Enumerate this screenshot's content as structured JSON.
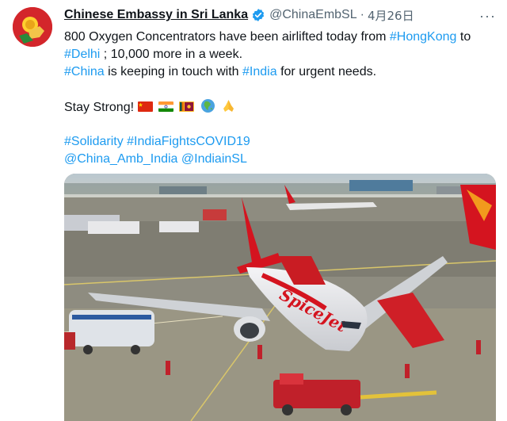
{
  "author": {
    "name": "Chinese Embassy in Sri Lanka",
    "handle": "@ChinaEmbSL",
    "date": "4月26日",
    "verified_icon": "verified-badge-icon",
    "more_icon": "more-options-icon"
  },
  "tweet": {
    "l1_pre": "800 Oxygen Concentrators have been airlifted today from ",
    "l1_tag": "#HongKong",
    "l1_post": " to",
    "l2_tag": "#Delhi",
    "l2_post": " ; 10,000 more in a week.",
    "l3_tag1": "#China",
    "l3_mid": " is keeping in touch with ",
    "l3_tag2": "#India",
    "l3_post": " for urgent needs.",
    "l4_text": "Stay Strong! ",
    "emoji": [
      "china-flag-icon",
      "india-flag-icon",
      "sri-lanka-flag-icon",
      "globe-asia-icon",
      "folded-hands-icon"
    ],
    "hashtag1": "#Solidarity",
    "hashtag2": "#IndiaFightsCOVID19",
    "mention1": "@China_Amb_India",
    "mention2": "@IndiainSL"
  },
  "media": {
    "subject": "spicejet-aircraft-photo",
    "livery_text": "SpiceJet"
  },
  "colors": {
    "link": "#1d9bf0",
    "text": "#0f1419",
    "muted": "#536471",
    "spicejet_red": "#d4141f"
  }
}
